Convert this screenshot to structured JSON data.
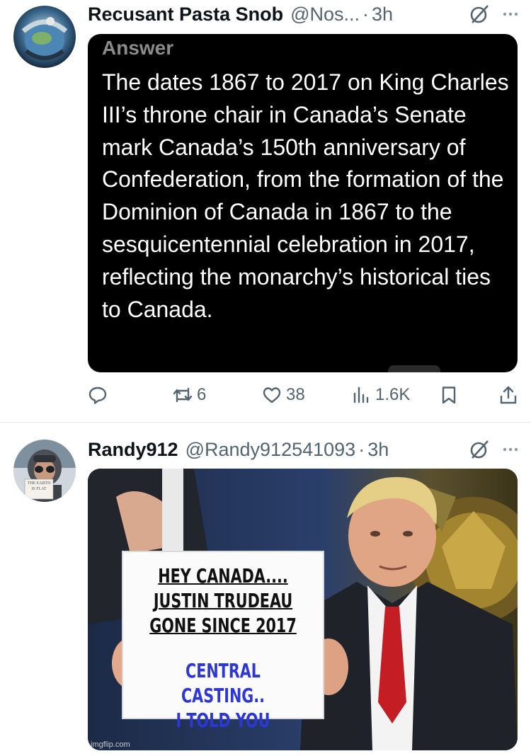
{
  "tweets": [
    {
      "author_name": "Recusant Pasta Snob",
      "handle": "@Nos...",
      "separator": "·",
      "time": "3h",
      "answer_label": "Answer",
      "answer_text": "The dates 1867 to 2017 on King Charles III’s throne chair in Canada’s Senate mark Canada’s 150th anniversary of Confederation, from the formation of the Dominion of Canada in 1867 to the sesquicentennial celebration in 2017, reflecting the monarchy’s historical ties to Canada.",
      "stats": {
        "retweets": "6",
        "likes": "38",
        "views": "1.6K"
      },
      "icons": [
        "grok-icon",
        "more-icon",
        "reply-icon",
        "retweet-icon",
        "like-icon",
        "views-icon",
        "bookmark-icon",
        "share-icon"
      ]
    },
    {
      "author_name": "Randy912",
      "handle": "@Randy912541093",
      "separator": "·",
      "time": "3h",
      "avatar_sign_text": "THE EARTH IS FLAT",
      "meme": {
        "sign_top_lines": [
          "HEY CANADA....",
          "JUSTIN TRUDEAU",
          "GONE SINCE 2017"
        ],
        "sign_bottom_lines": [
          "CENTRAL CASTING..",
          "I TOLD YOU"
        ],
        "watermark": "imgflip.com"
      },
      "icons": [
        "grok-icon",
        "more-icon"
      ]
    }
  ],
  "colors": {
    "text_primary": "#0f1419",
    "text_secondary": "#536471",
    "card_background": "#000000",
    "sign_blue_text": "#2d36d6"
  }
}
